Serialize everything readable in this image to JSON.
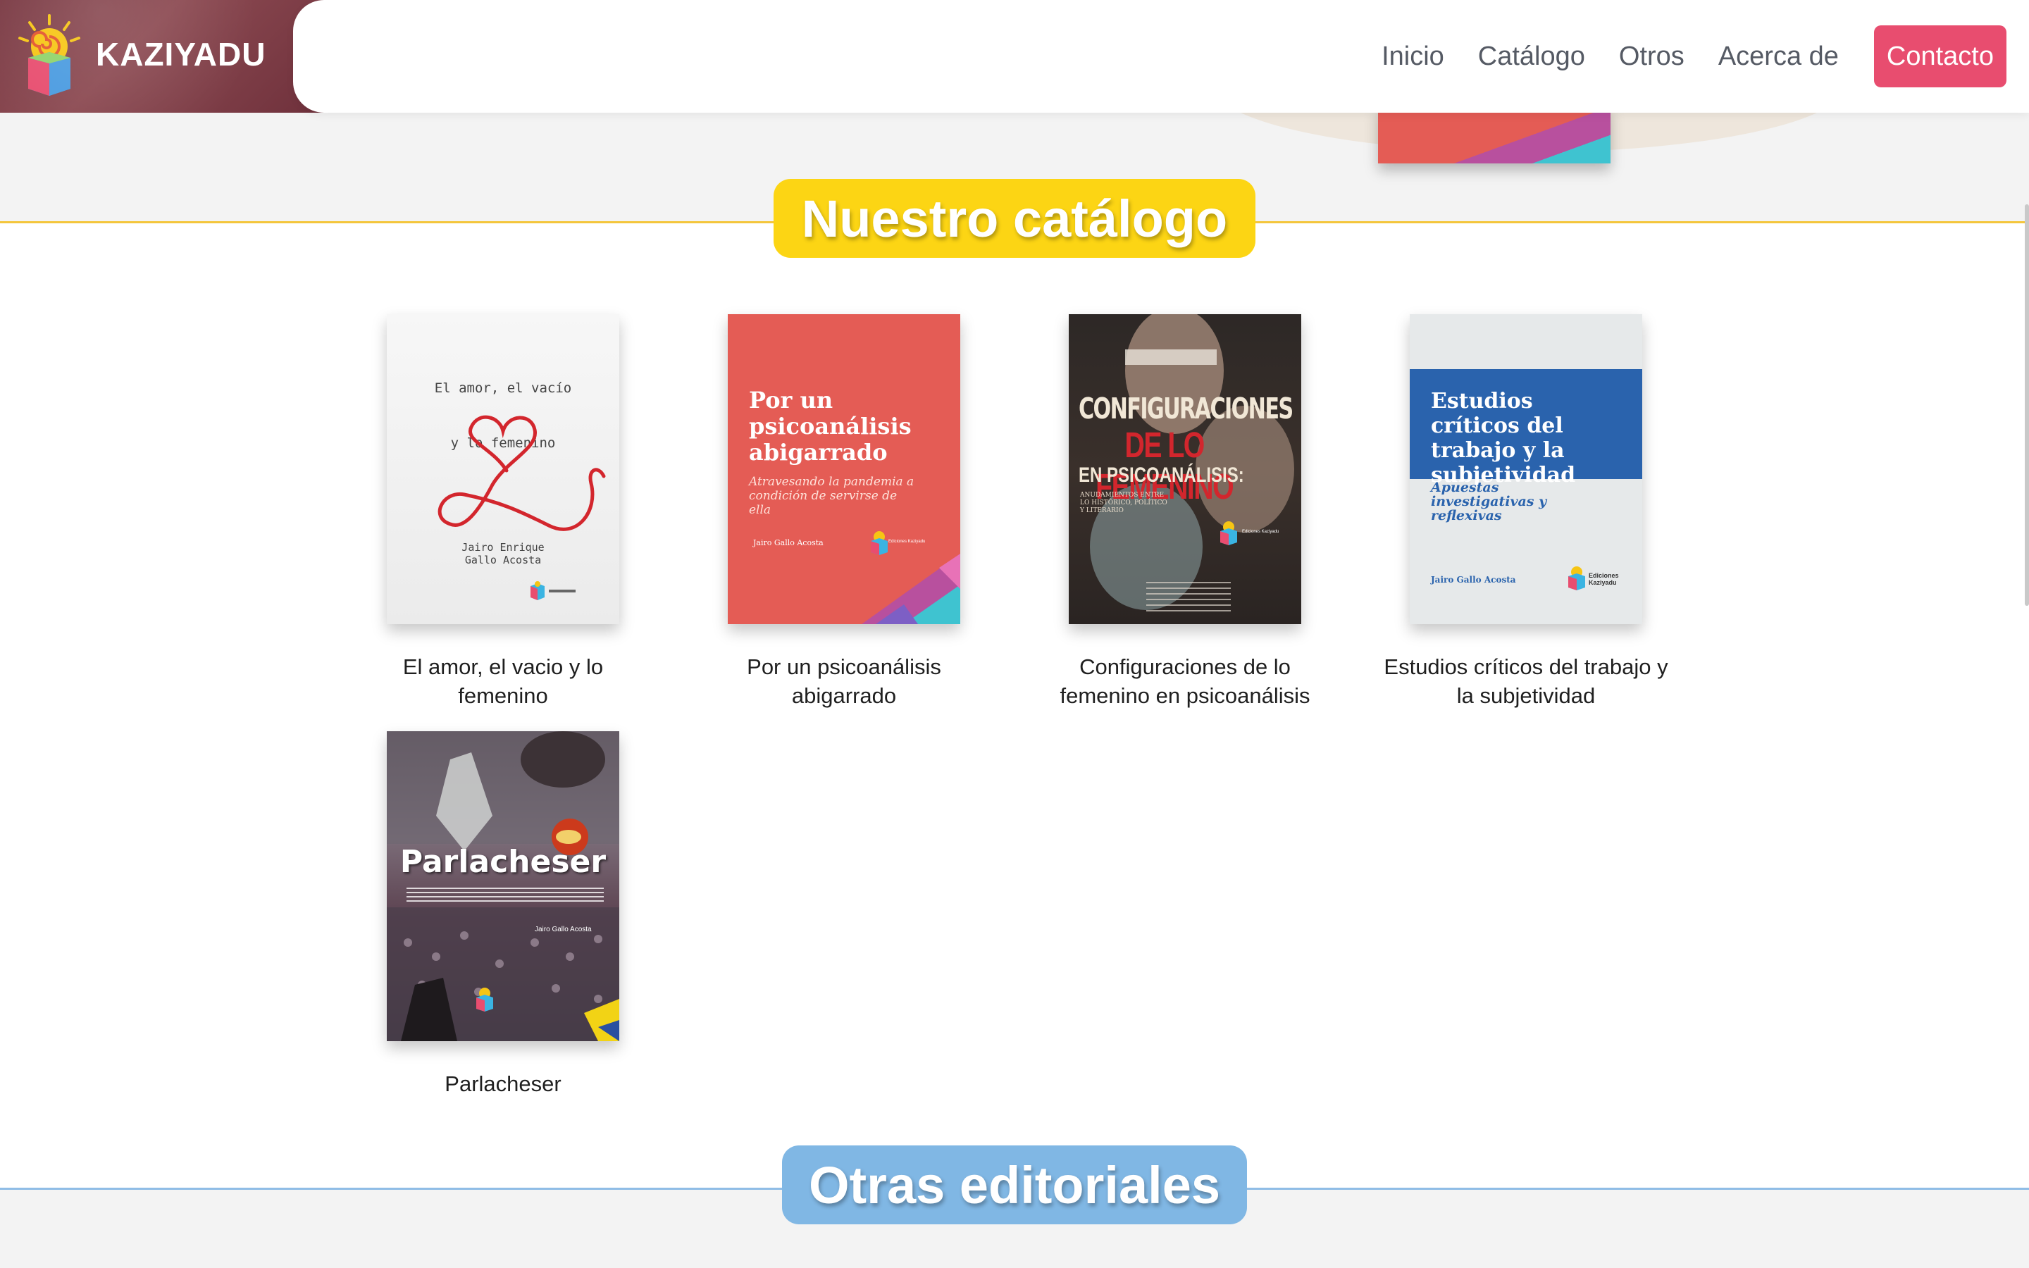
{
  "header": {
    "brand": "KAZIYADU",
    "nav": [
      {
        "label": "Inicio"
      },
      {
        "label": "Catálogo"
      },
      {
        "label": "Otros"
      },
      {
        "label": "Acerca de"
      }
    ],
    "contact_label": "Contacto"
  },
  "catalog": {
    "heading": "Nuestro catálogo",
    "books": [
      {
        "title": "El amor, el vacio y lo femenino",
        "cover": {
          "line1": "El amor, el vacío",
          "line2": "y lo femenino",
          "author1": "Jairo Enrique",
          "author2": "Gallo Acosta"
        }
      },
      {
        "title": "Por un psicoanálisis abigarrado",
        "cover": {
          "title": "Por un psicoanálisis abigarrado",
          "subtitle": "Atravesando la pandemia a condición de servirse de ella",
          "author": "Jairo Gallo Acosta",
          "publisher": "Ediciones Kaziyadu"
        }
      },
      {
        "title": "Configuraciones de lo femenino en psicoanálisis",
        "cover": {
          "line1": "CONFIGURACIONES",
          "line2": "DE LO FEMENINO",
          "line3": "EN PSICOANÁLISIS:",
          "sub": "ANUDAMIENTOS ENTRE LO HISTÓRICO, POLÍTICO Y LITERARIO",
          "publisher": "Ediciones Kaziyadu"
        }
      },
      {
        "title": "Estudios críticos del trabajo y la subjetividad",
        "cover": {
          "title": "Estudios críticos del trabajo y la subjetividad",
          "subtitle": "Apuestas investigativas y reflexivas",
          "author": "Jairo Gallo Acosta",
          "publisher": "Ediciones Kaziyadu"
        }
      },
      {
        "title": "Parlacheser",
        "cover": {
          "title": "Parlacheser",
          "author": "Jairo Gallo Acosta"
        }
      }
    ]
  },
  "others": {
    "heading": "Otras editoriales"
  },
  "colors": {
    "yellow": "#fcd514",
    "blue": "#80b7e4",
    "contact": "#e84d6f",
    "brand_strip": "#7a3a44"
  }
}
